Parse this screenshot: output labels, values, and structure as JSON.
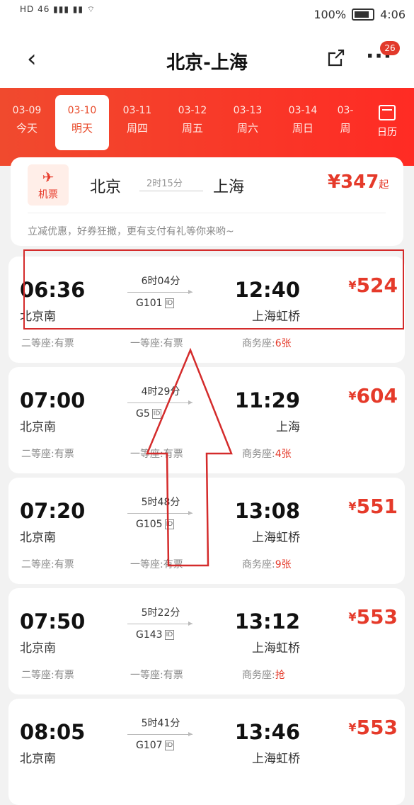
{
  "status_bar": {
    "left_icons": "HD 46 ▮▮▮ ▮▮ ⌔",
    "battery": "100%",
    "time": "4:06"
  },
  "header": {
    "title": "北京-上海",
    "more_badge": "26"
  },
  "dates": [
    {
      "date": "03-09",
      "week": "今天"
    },
    {
      "date": "03-10",
      "week": "明天",
      "selected": true
    },
    {
      "date": "03-11",
      "week": "周四"
    },
    {
      "date": "03-12",
      "week": "周五"
    },
    {
      "date": "03-13",
      "week": "周六"
    },
    {
      "date": "03-14",
      "week": "周日"
    },
    {
      "date": "03-",
      "week": "周"
    }
  ],
  "calendar_label": "日历",
  "flight": {
    "tag": "机票",
    "from": "北京",
    "duration": "2时15分",
    "to": "上海",
    "price": "¥347",
    "price_suffix": "起",
    "promo": "立减优惠，好券狂撒，更有支付有礼等你来哟~"
  },
  "trains": [
    {
      "dep_time": "06:36",
      "dep_station": "北京南",
      "duration": "6时04分",
      "train_no": "G101",
      "arr_time": "12:40",
      "arr_station": "上海虹桥",
      "price": "524",
      "seat1": "二等座:有票",
      "seat2": "一等座:有票",
      "seat3_label": "商务座:",
      "seat3_value": "6张"
    },
    {
      "dep_time": "07:00",
      "dep_station": "北京南",
      "duration": "4时29分",
      "train_no": "G5",
      "arr_time": "11:29",
      "arr_station": "上海",
      "price": "604",
      "seat1": "二等座:有票",
      "seat2": "一等座:有票",
      "seat3_label": "商务座:",
      "seat3_value": "4张"
    },
    {
      "dep_time": "07:20",
      "dep_station": "北京南",
      "duration": "5时48分",
      "train_no": "G105",
      "arr_time": "13:08",
      "arr_station": "上海虹桥",
      "price": "551",
      "seat1": "二等座:有票",
      "seat2": "一等座:有票",
      "seat3_label": "商务座:",
      "seat3_value": "9张"
    },
    {
      "dep_time": "07:50",
      "dep_station": "北京南",
      "duration": "5时22分",
      "train_no": "G143",
      "arr_time": "13:12",
      "arr_station": "上海虹桥",
      "price": "553",
      "seat1": "二等座:有票",
      "seat2": "一等座:有票",
      "seat3_label": "商务座:",
      "seat3_value": "抢"
    },
    {
      "dep_time": "08:05",
      "dep_station": "北京南",
      "duration": "5时41分",
      "train_no": "G107",
      "arr_time": "13:46",
      "arr_station": "上海虹桥",
      "price": "553",
      "seat1": "",
      "seat2": "",
      "seat3_label": "",
      "seat3_value": ""
    }
  ],
  "id_icon_text": "ID",
  "currency": "¥",
  "colors": {
    "accent": "#e53a2a",
    "header_gradient_start": "#f04a2e",
    "annotation": "#d42b2b"
  }
}
